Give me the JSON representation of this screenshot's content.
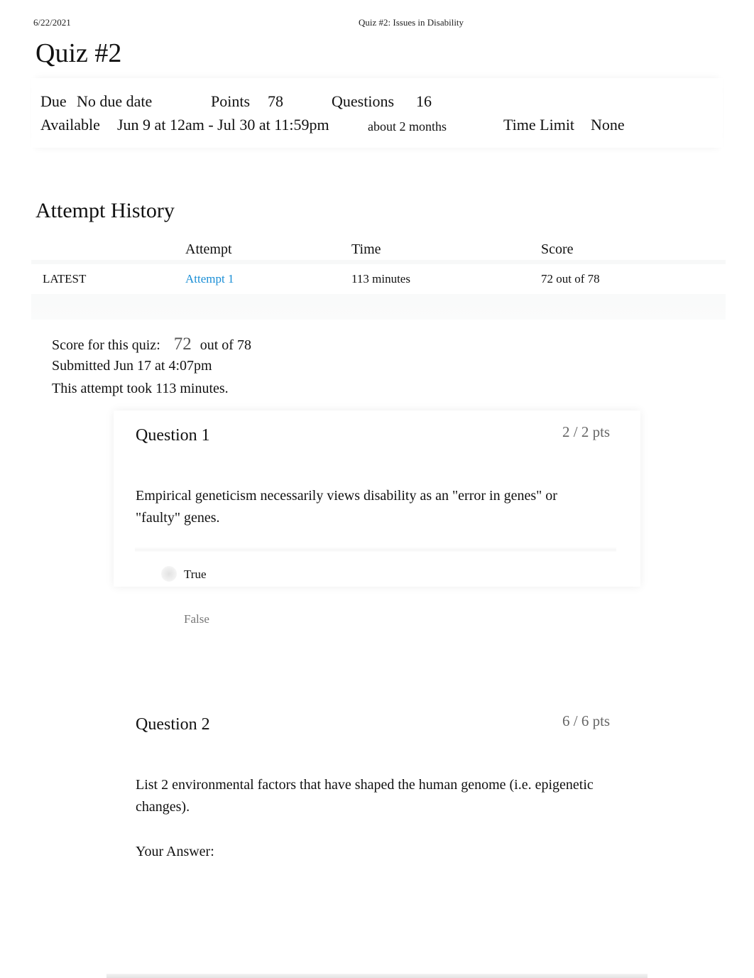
{
  "print_header": {
    "date": "6/22/2021",
    "title": "Quiz #2: Issues in Disability"
  },
  "quiz": {
    "title": "Quiz #2",
    "details": {
      "due_label": "Due",
      "due_value": "No due date",
      "points_label": "Points",
      "points_value": "78",
      "questions_label": "Questions",
      "questions_value": "16",
      "available_label": "Available",
      "available_value": "Jun 9 at 12am - Jul 30 at 11:59pm",
      "available_duration": "about 2 months",
      "time_limit_label": "Time Limit",
      "time_limit_value": "None"
    }
  },
  "attempt_history": {
    "title": "Attempt History",
    "columns": [
      "",
      "Attempt",
      "Time",
      "Score"
    ],
    "rows": [
      {
        "tag": "LATEST",
        "attempt": "Attempt 1",
        "time": "113 minutes",
        "score": "72 out of 78"
      }
    ]
  },
  "summary": {
    "score_label": "Score for this quiz:",
    "score_value": "72",
    "score_out_of": "out of 78",
    "submitted": "Submitted Jun 17 at 4:07pm",
    "duration": "This attempt took 113 minutes."
  },
  "questions": [
    {
      "title": "Question 1",
      "points": "2 / 2 pts",
      "text": "Empirical geneticism necessarily views disability as an \"error in genes\" or \"faulty\" genes.",
      "answers": [
        {
          "label": "True",
          "selected": true
        },
        {
          "label": "False",
          "selected": false
        }
      ]
    },
    {
      "title": "Question 2",
      "points": "6 / 6 pts",
      "text": "List 2 environmental factors that have shaped the human genome (i.e. epigenetic changes).",
      "answer_label": "Your Answer:"
    }
  ],
  "colors": {
    "link": "#1b8fd6",
    "muted_text": "#666666"
  }
}
